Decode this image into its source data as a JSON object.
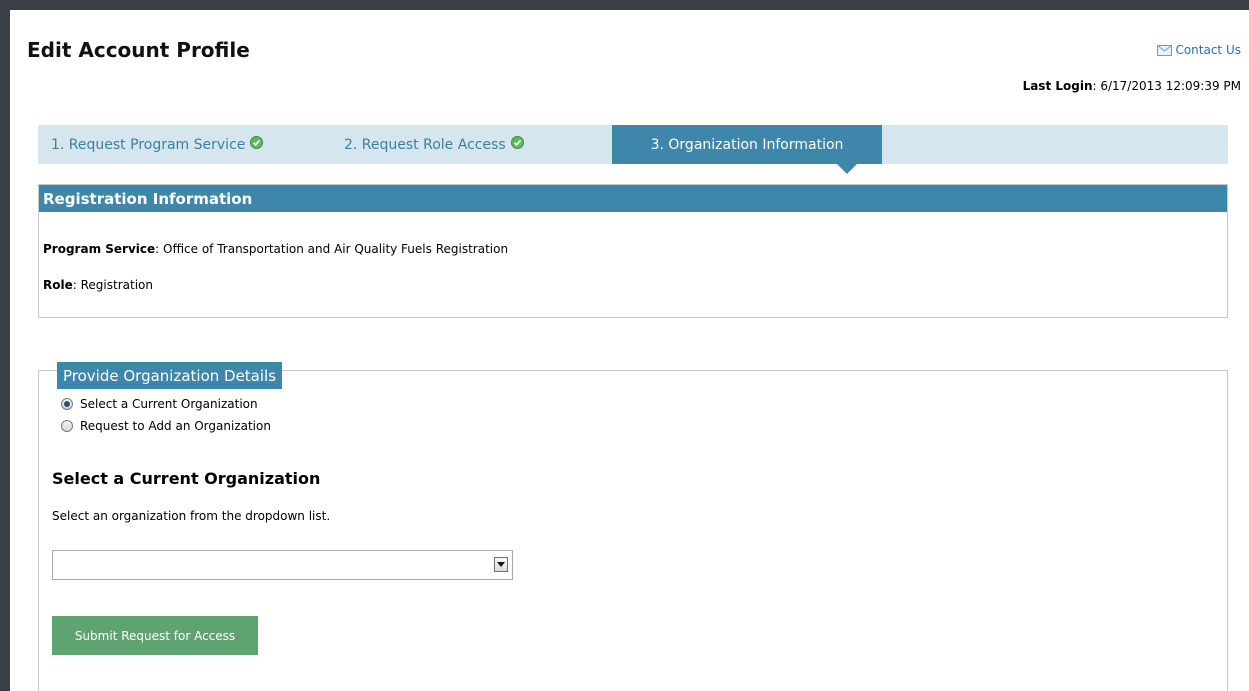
{
  "header": {
    "title": "Edit Account Profile",
    "contact_label": "Contact Us",
    "last_login_label": "Last Login",
    "last_login_value": ": 6/17/2013 12:09:39 PM"
  },
  "tabs": [
    {
      "label": "1. Request Program Service",
      "completed": true
    },
    {
      "label": "2. Request Role Access",
      "completed": true
    },
    {
      "label": "3. Organization Information",
      "active": true
    }
  ],
  "registration": {
    "header": "Registration Information",
    "program_service_label": "Program Service",
    "program_service_value": ": Office of Transportation and Air Quality Fuels Registration",
    "role_label": "Role",
    "role_value": ": Registration"
  },
  "organization": {
    "legend": "Provide Organization Details",
    "options": [
      {
        "label": "Select a Current Organization",
        "selected": true
      },
      {
        "label": "Request to Add an Organization",
        "selected": false
      }
    ],
    "section_title": "Select a Current Organization",
    "instruction": "Select an organization from the dropdown list.",
    "dropdown_value": "",
    "submit_label": "Submit Request for Access"
  },
  "colors": {
    "accent": "#3e87aa",
    "tab_bar": "#d6e6ee",
    "submit": "#5fa371",
    "link": "#2a6ebb",
    "check": "#5bb85d"
  }
}
